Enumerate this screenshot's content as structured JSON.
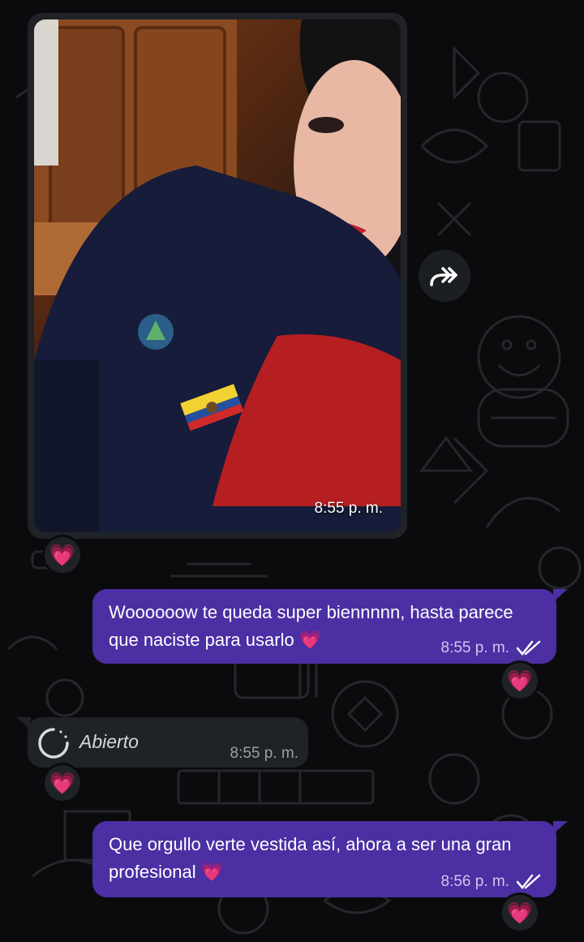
{
  "colors": {
    "background": "#0b0b0d",
    "incoming_bubble": "#1f2327",
    "outgoing_bubble": "#4b2fa3",
    "text": "#ffffff",
    "meta_text": "#cfc7ee",
    "read_check": "#ffffff"
  },
  "messages": [
    {
      "type": "photo",
      "direction": "incoming",
      "time": "8:55 p. m.",
      "reaction": "💗"
    },
    {
      "type": "text",
      "direction": "outgoing",
      "text": "Woooooow te queda super biennnnn, hasta parece que naciste para usarlo 💗",
      "time": "8:55 p. m.",
      "status_icon": "double-check-icon",
      "reaction": "💗"
    },
    {
      "type": "view-once",
      "direction": "incoming",
      "text": "Abierto",
      "time": "8:55 p. m.",
      "reaction": "💗"
    },
    {
      "type": "text",
      "direction": "outgoing",
      "text": "Que orgullo verte vestida así, ahora a ser una gran profesional 💗",
      "time": "8:56 p. m.",
      "status_icon": "double-check-icon",
      "reaction": "💗"
    }
  ],
  "icons": {
    "forward": "forward-icon",
    "view_once": "view-once-icon"
  }
}
